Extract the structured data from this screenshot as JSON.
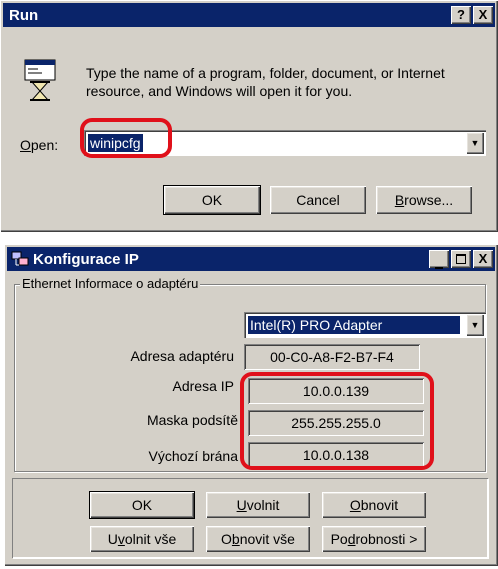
{
  "run": {
    "title": "Run",
    "help_btn": "?",
    "close_btn": "X",
    "description": "Type the name of a program, folder, document, or Internet resource, and Windows will open it for you.",
    "open_label_u": "O",
    "open_label_rest": "pen:",
    "open_value": "winipcfg",
    "ok": "OK",
    "cancel": "Cancel",
    "browse_u": "B",
    "browse_rest": "rowse..."
  },
  "ipconfig": {
    "title": "Konfigurace IP",
    "group_label": "Ethernet  Informace o adaptéru",
    "adapter": "Intel(R) PRO Adapter",
    "rows": [
      {
        "label": "Adresa adaptéru",
        "value": "00-C0-A8-F2-B7-F4"
      },
      {
        "label": "Adresa IP",
        "value": "10.0.0.139"
      },
      {
        "label": "Maska podsítě",
        "value": "255.255.255.0"
      },
      {
        "label": "Výchozí brána",
        "value": "10.0.0.138"
      }
    ],
    "buttons": {
      "ok": "OK",
      "uvolnit_u": "U",
      "uvolnit_rest": "volnit",
      "obnovit_u": "O",
      "obnovit_rest": "bnovit",
      "uvolnit_vse_pre": "U",
      "uvolnit_vse_u": "v",
      "uvolnit_vse_rest": "olnit vše",
      "obnovit_vse_pre": "O",
      "obnovit_vse_u": "b",
      "obnovit_vse_rest": "novit vše",
      "podrobnosti_pre": "Po",
      "podrobnosti_u": "d",
      "podrobnosti_rest": "robnosti >"
    }
  }
}
